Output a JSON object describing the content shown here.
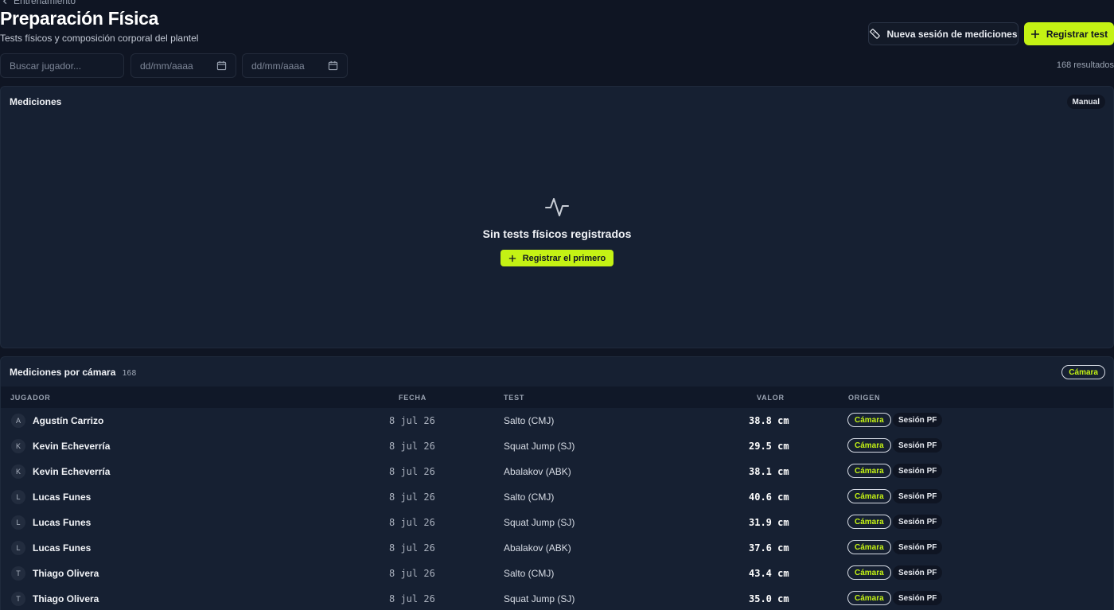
{
  "header": {
    "back_label": "Entrenamiento",
    "title": "Preparación Física",
    "subtitle": "Tests físicos y composición corporal del plantel",
    "new_session_label": "Nueva sesión de mediciones",
    "register_label": "Registrar test"
  },
  "filters": {
    "search_placeholder": "Buscar jugador...",
    "date_from_placeholder": "dd/mm/aaaa",
    "date_to_placeholder": "dd/mm/aaaa",
    "results": "168 resultados"
  },
  "manual_panel": {
    "title": "Mediciones",
    "badge": "Manual",
    "empty_text": "Sin tests físicos registrados",
    "empty_button": "Registrar el primero"
  },
  "camera_panel": {
    "title": "Mediciones por cámara",
    "count": "168",
    "badge": "Cámara",
    "columns": {
      "player": "JUGADOR",
      "date": "FECHA",
      "test": "TEST",
      "value": "VALOR",
      "origin": "ORIGEN"
    },
    "rows": [
      {
        "initial": "A",
        "player": "Agustín Carrizo",
        "date": "8 jul 26",
        "test": "Salto (CMJ)",
        "value": "38.8 cm",
        "origin": "Cámara",
        "source": "Sesión PF"
      },
      {
        "initial": "K",
        "player": "Kevin Echeverría",
        "date": "8 jul 26",
        "test": "Squat Jump (SJ)",
        "value": "29.5 cm",
        "origin": "Cámara",
        "source": "Sesión PF"
      },
      {
        "initial": "K",
        "player": "Kevin Echeverría",
        "date": "8 jul 26",
        "test": "Abalakov (ABK)",
        "value": "38.1 cm",
        "origin": "Cámara",
        "source": "Sesión PF"
      },
      {
        "initial": "L",
        "player": "Lucas Funes",
        "date": "8 jul 26",
        "test": "Salto (CMJ)",
        "value": "40.6 cm",
        "origin": "Cámara",
        "source": "Sesión PF"
      },
      {
        "initial": "L",
        "player": "Lucas Funes",
        "date": "8 jul 26",
        "test": "Squat Jump (SJ)",
        "value": "31.9 cm",
        "origin": "Cámara",
        "source": "Sesión PF"
      },
      {
        "initial": "L",
        "player": "Lucas Funes",
        "date": "8 jul 26",
        "test": "Abalakov (ABK)",
        "value": "37.6 cm",
        "origin": "Cámara",
        "source": "Sesión PF"
      },
      {
        "initial": "T",
        "player": "Thiago Olivera",
        "date": "8 jul 26",
        "test": "Salto (CMJ)",
        "value": "43.4 cm",
        "origin": "Cámara",
        "source": "Sesión PF"
      },
      {
        "initial": "T",
        "player": "Thiago Olivera",
        "date": "8 jul 26",
        "test": "Squat Jump (SJ)",
        "value": "35.0 cm",
        "origin": "Cámara",
        "source": "Sesión PF"
      }
    ]
  },
  "colors": {
    "accent": "#c4f214",
    "background": "#0f1523",
    "panel": "#162032"
  }
}
